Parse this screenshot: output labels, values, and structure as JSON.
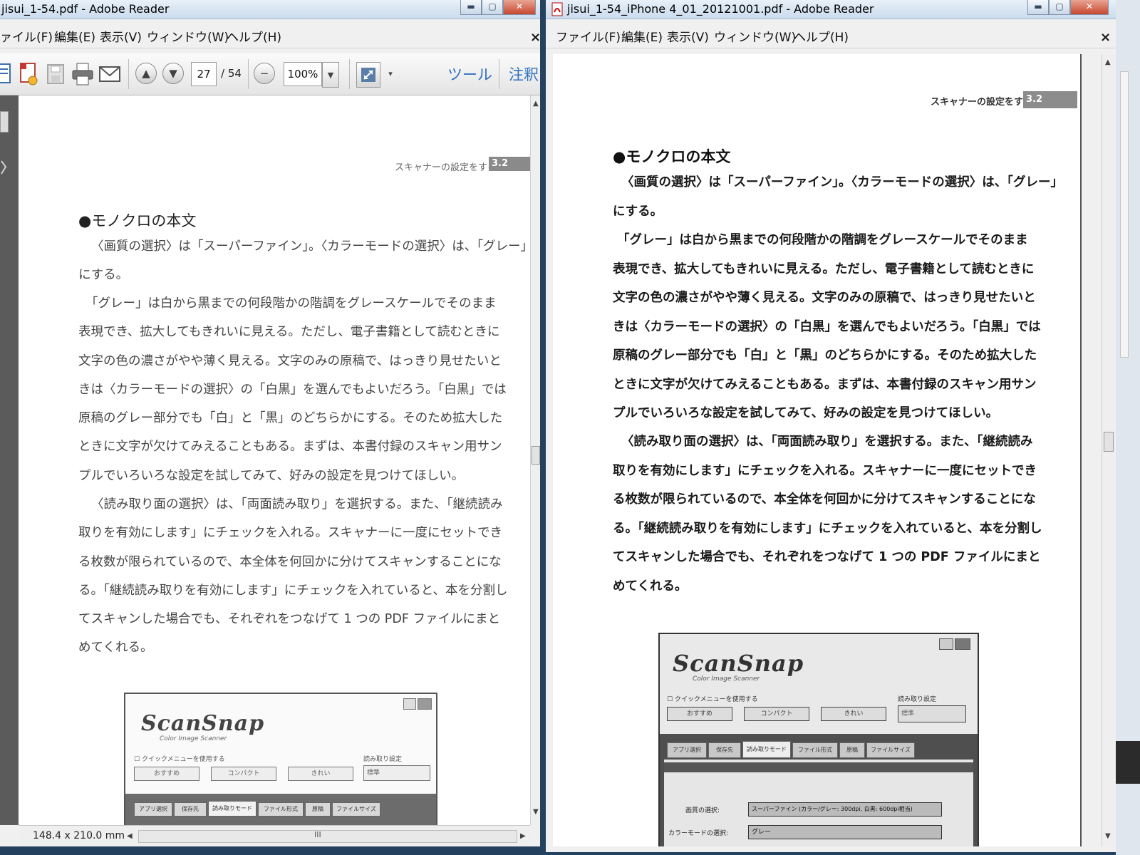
{
  "left_window": {
    "title": "jisui_1-54.pdf - Adobe Reader",
    "menu": [
      "ァイル(F)",
      "編集(E)",
      "表示(V)",
      "ウィンドウ(W)",
      "ヘルプ(H)"
    ],
    "menu_close": "×",
    "toolbar": {
      "page_current": "27",
      "page_total": "/ 54",
      "zoom": "100%",
      "tools_label": "ツール",
      "comment_label": "注釈"
    },
    "status_size": "148.4 x 210.0 mm",
    "scroll_grip": "III"
  },
  "right_window": {
    "title": "jisui_1-54_iPhone 4_01_20121001.pdf - Adobe Reader",
    "menu": [
      "ファイル(F)",
      "編集(E)",
      "表示(V)",
      "ウィンドウ(W)",
      "ヘルプ(H)"
    ],
    "menu_close": "×"
  },
  "window_buttons": {
    "minimize": "▬",
    "maximize": "▢",
    "close": "✕"
  },
  "page": {
    "running_head": "スキャナーの設定をする",
    "section_number": "3.2",
    "heading": "●モノクロの本文",
    "para1": [
      "〈画質の選択〉は「スーパーファイン」。〈カラーモードの選択〉は、「グレー」",
      "にする。"
    ],
    "para2": [
      "「グレー」は白から黒までの何段階かの階調をグレースケールでそのまま",
      "表現でき、拡大してもきれいに見える。ただし、電子書籍として読むときに",
      "文字の色の濃さがやや薄く見える。文字のみの原稿で、はっきり見せたいと",
      "きは〈カラーモードの選択〉の「白黒」を選んでもよいだろう。「白黒」では",
      "原稿のグレー部分でも「白」と「黒」のどちらかにする。そのため拡大した",
      "ときに文字が欠けてみえることもある。まずは、本書付録のスキャン用サン",
      "プルでいろいろな設定を試してみて、好みの設定を見つけてほしい。"
    ],
    "para3": [
      "〈読み取り面の選択〉は、「両面読み取り」を選択する。また、「継続読み",
      "取りを有効にします」にチェックを入れる。スキャナーに一度にセットでき",
      "る枚数が限られているので、本全体を何回かに分けてスキャンすることにな",
      "る。「継続読み取りを有効にします」にチェックを入れていると、本を分割し",
      "てスキャンした場合でも、それぞれをつなげて 1 つの PDF ファイルにまと",
      "めてくれる。"
    ]
  },
  "scansnap_shot": {
    "logo": "ScanSnap",
    "sublogo": "Color Image Scanner",
    "quick_menu_checkbox": "クイックメニューを使用する",
    "read_settings_label": "読み取り設定",
    "read_settings_value": "標準",
    "buttons": [
      "おすすめ",
      "コンパクト",
      "きれい"
    ],
    "tabs": [
      "アプリ選択",
      "保存先",
      "読み取りモード",
      "ファイル形式",
      "原稿",
      "ファイルサイズ"
    ],
    "right_rows": [
      {
        "label": "画質の選択:",
        "value": "スーパーファイン (カラー/グレー: 300dpi, 白黒: 600dpi相当)"
      },
      {
        "label": "カラーモードの選択:",
        "value": "グレー"
      }
    ]
  },
  "colors": {
    "desktop": "#23405e",
    "reader_blue": "#2d6fc0",
    "page_gray_box": "#8a8a8a"
  }
}
